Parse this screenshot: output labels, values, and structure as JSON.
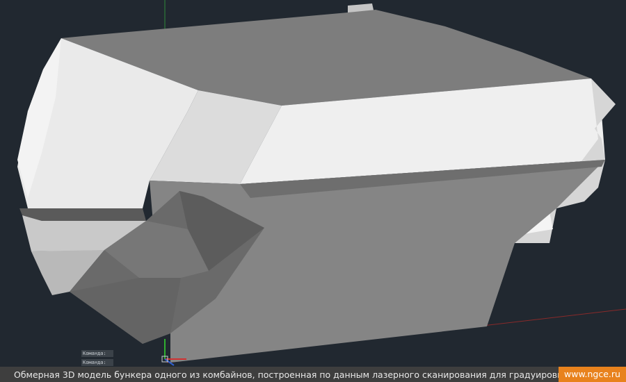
{
  "command_prompt": {
    "line1": "Команда:",
    "line2": "Команда:"
  },
  "footer": {
    "caption": "Обмерная 3D модель бункера одного из комбайнов, построенная по данным лазерного сканирования для градуировки",
    "site": "www.ngce.ru"
  },
  "colors": {
    "viewport_background": "#212830",
    "caption_background": "#3e3e3e",
    "site_badge": "#e8821d",
    "axis_x": "#d03030",
    "axis_y": "#30b030",
    "axis_z": "#3060d0"
  }
}
